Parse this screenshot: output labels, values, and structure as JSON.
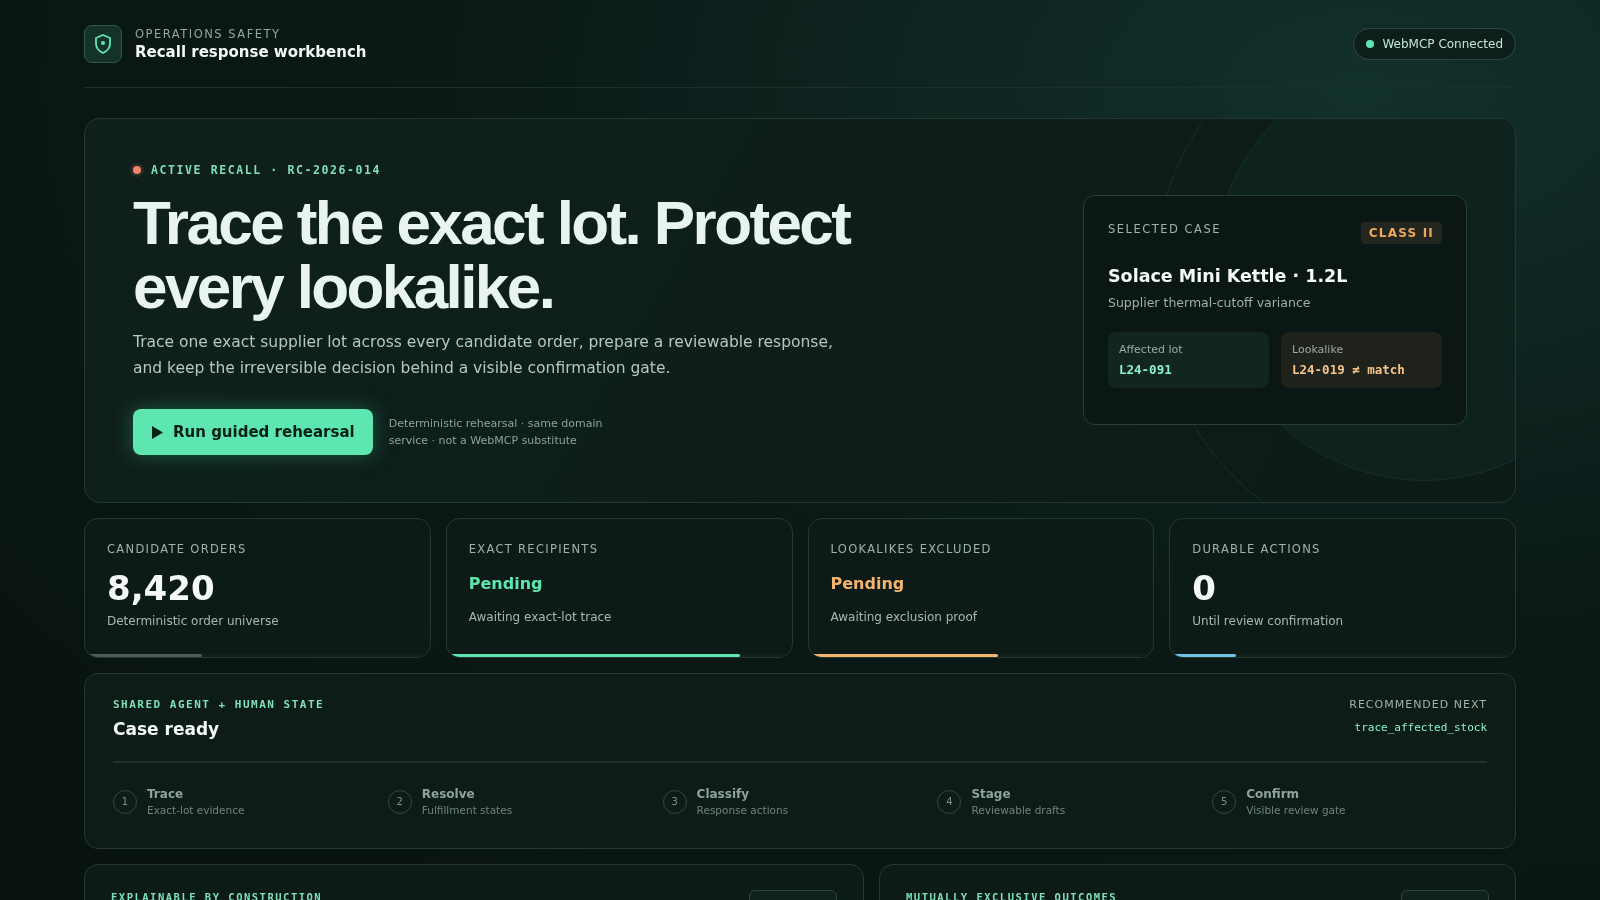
{
  "header": {
    "eyebrow": "OPERATIONS SAFETY",
    "title": "Recall response workbench",
    "status": {
      "label": "WebMCP Connected",
      "on": true
    }
  },
  "hero": {
    "badge": "ACTIVE RECALL · RC-2026-014",
    "headline": "Trace the exact lot. Protect every lookalike.",
    "lead": "Trace one exact supplier lot across every candidate order, prepare a reviewable response, and keep the irreversible decision behind a visible confirmation gate.",
    "button": "Run guided rehearsal",
    "note": "Deterministic rehearsal · same domain service · not a WebMCP substitute",
    "case": {
      "label": "SELECTED CASE",
      "class": "CLASS II",
      "product": "Solace Mini Kettle · 1.2L",
      "issue": "Supplier thermal-cutoff variance",
      "lots": [
        {
          "kind": "affected",
          "label": "Affected lot",
          "value": "L24-091"
        },
        {
          "kind": "lookalike",
          "label": "Lookalike",
          "value": "L24-019 ≠ match"
        }
      ]
    }
  },
  "stats": [
    {
      "kind": "number",
      "label": "CANDIDATE ORDERS",
      "value": "8,420",
      "caption": "Deterministic order universe",
      "level": 0.34,
      "color": "#4d5c57"
    },
    {
      "kind": "status",
      "label": "EXACT RECIPIENTS",
      "value": "Pending",
      "caption": "Awaiting exact-lot trace",
      "level": 0.85,
      "color": "#5ee6b0"
    },
    {
      "kind": "status",
      "label": "LOOKALIKES EXCLUDED",
      "value": "Pending",
      "caption": "Awaiting exclusion proof",
      "level": 0.55,
      "color": "#f5b36b"
    },
    {
      "kind": "number",
      "label": "DURABLE ACTIONS",
      "value": "0",
      "caption": "Until review confirmation",
      "level": 0.19,
      "color": "#6ec3e8"
    }
  ],
  "state": {
    "eyebrow": "SHARED AGENT + HUMAN STATE",
    "title": "Case ready",
    "next_label": "RECOMMENDED NEXT",
    "next_value": "trace_affected_stock",
    "steps": [
      {
        "number": "1",
        "title": "Trace",
        "caption": "Exact-lot evidence"
      },
      {
        "number": "2",
        "title": "Resolve",
        "caption": "Fulfillment states"
      },
      {
        "number": "3",
        "title": "Classify",
        "caption": "Response actions"
      },
      {
        "number": "4",
        "title": "Stage",
        "caption": "Reviewable drafts"
      },
      {
        "number": "5",
        "title": "Confirm",
        "caption": "Visible review gate"
      }
    ]
  },
  "panels": [
    {
      "title": "EXPLAINABLE BY CONSTRUCTION"
    },
    {
      "title": "MUTUALLY EXCLUSIVE OUTCOMES"
    }
  ]
}
